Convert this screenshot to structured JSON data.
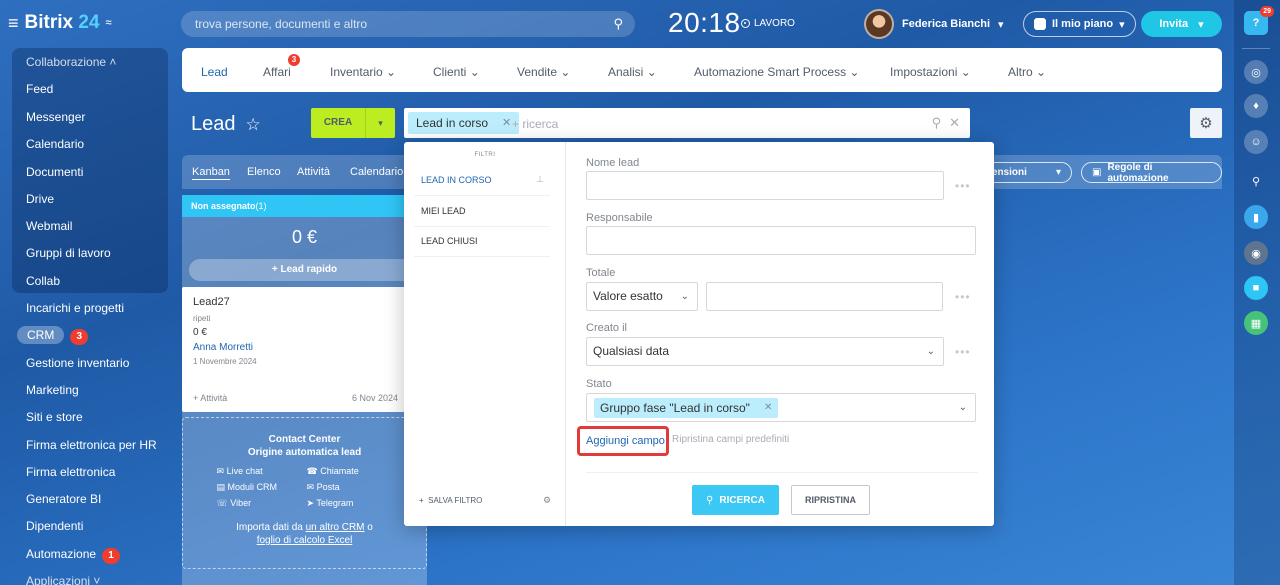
{
  "app": {
    "brand": "Bitrix",
    "brand_num": "24"
  },
  "topbar": {
    "search_placeholder": "trova persone, documenti e altro",
    "clock": "20:18",
    "work_status": "LAVORO",
    "user_name": "Federica Bianchi",
    "plan_label": "Il mio piano",
    "invite_label": "Invita"
  },
  "leftmenu": {
    "items": [
      "Collaborazione",
      "Feed",
      "Messenger",
      "Calendario",
      "Documenti",
      "Drive",
      "Webmail",
      "Gruppi di lavoro",
      "Collab",
      "Incarichi e progetti",
      "CRM",
      "Gestione inventario",
      "Marketing",
      "Siti e store",
      "Firma elettronica per HR",
      "Firma elettronica",
      "Generatore BI",
      "Dipendenti",
      "Automazione",
      "Applicazioni"
    ],
    "crm_badge": "3",
    "automation_badge": "1"
  },
  "mainnav": {
    "items": [
      "Lead",
      "Affari",
      "Inventario",
      "Clienti",
      "Vendite",
      "Analisi",
      "Automazione Smart Process",
      "Impostazioni",
      "Altro"
    ],
    "deals_badge": "3"
  },
  "page": {
    "title": "Lead",
    "create_label": "CREA",
    "filter_chip": "Lead in corso",
    "filter_placeholder": "+ ricerca"
  },
  "views": {
    "tabs": [
      "Kanban",
      "Elenco",
      "Attività",
      "Calendario"
    ],
    "extensions_label": "stensioni",
    "automation_rules_label": "Regole di automazione"
  },
  "kanban": {
    "column_title": "Non assegnato",
    "column_count": "(1)",
    "column_sum": "0 €",
    "quick_lead": "+ Lead rapido",
    "card": {
      "title": "Lead27",
      "subtitle": "ripeti",
      "amount": "0 €",
      "contact": "Anna Morretti",
      "created": "1 Novembre 2024",
      "activity": "+ Attività",
      "date": "6 Nov 2024"
    },
    "contact_center": {
      "title": "Contact Center",
      "subtitle": "Origine automatica lead",
      "channels": [
        "Live chat",
        "Chiamate",
        "Moduli CRM",
        "Posta",
        "Viber",
        "Telegram"
      ],
      "import_prefix": "Importa dati da ",
      "import_link1": "un altro CRM",
      "import_mid": " o",
      "import_link2": "foglio di calcolo Excel"
    }
  },
  "filter_popup": {
    "title": "FILTRI",
    "presets": [
      "LEAD IN CORSO",
      "MIEI LEAD",
      "LEAD CHIUSI"
    ],
    "save_filter": "SALVA FILTRO",
    "fields": {
      "name_label": "Nome lead",
      "responsible_label": "Responsabile",
      "total_label": "Totale",
      "total_mode": "Valore esatto",
      "created_label": "Creato il",
      "created_value": "Qualsiasi data",
      "status_label": "Stato",
      "status_chip": "Gruppo fase \"Lead in corso\""
    },
    "add_field": "Aggiungi campo",
    "restore_fields": "Ripristina campi predefiniti",
    "search_button": "RICERCA",
    "reset_button": "RIPRISTINA"
  },
  "rail": {
    "help_badge": "29"
  },
  "colors": {
    "accent": "#2fc6f6",
    "create": "#bbed21",
    "highlight": "#e03a3a",
    "link": "#2067b0"
  }
}
